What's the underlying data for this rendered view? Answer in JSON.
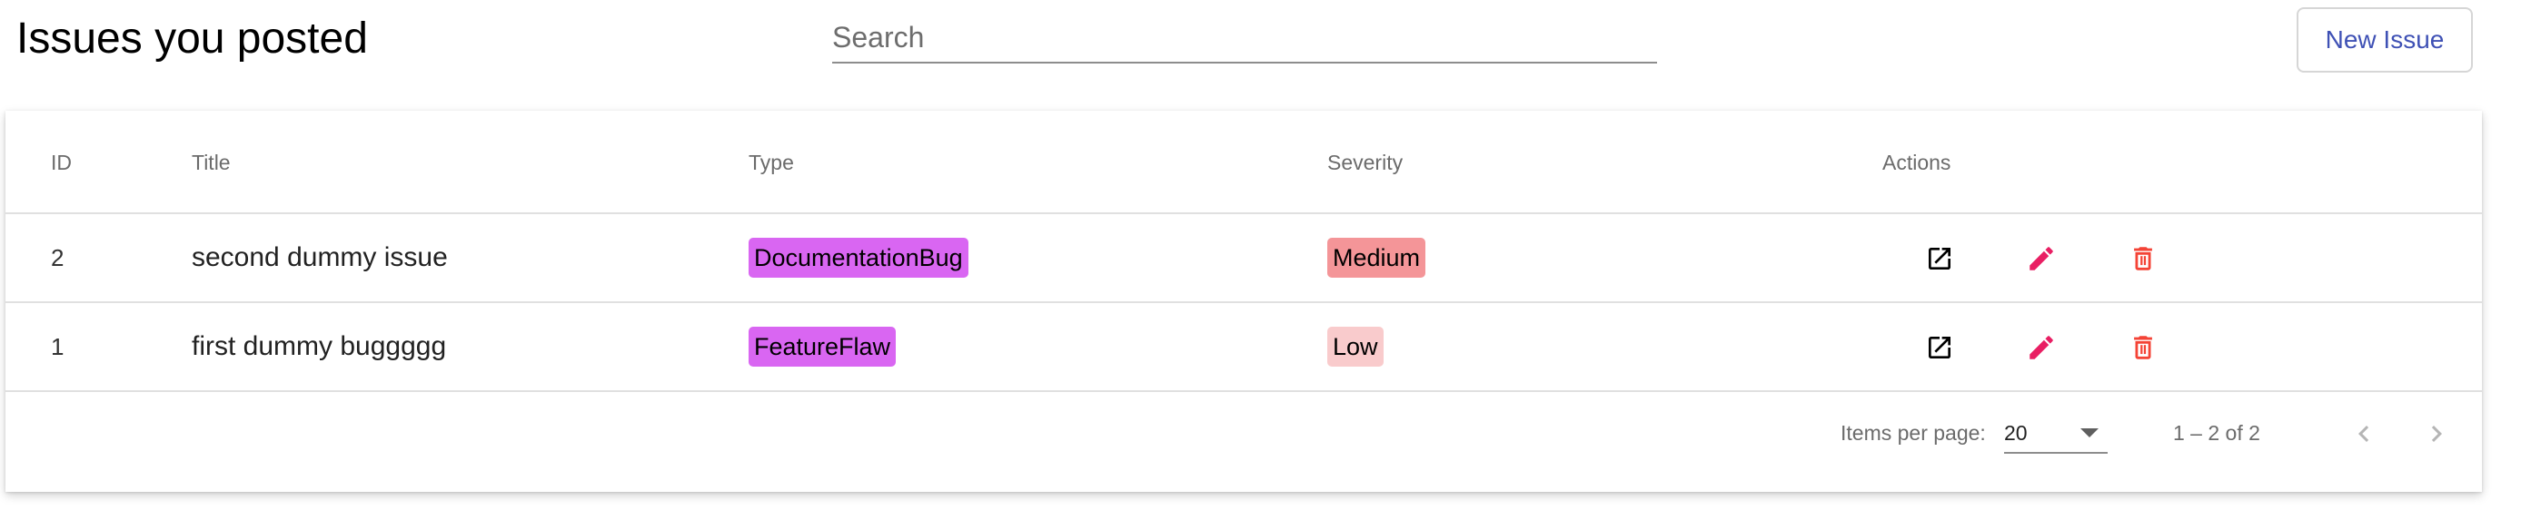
{
  "header": {
    "title": "Issues you posted",
    "search_placeholder": "Search",
    "search_value": "",
    "new_issue_label": "New Issue"
  },
  "table": {
    "columns": [
      "ID",
      "Title",
      "Type",
      "Severity",
      "Actions"
    ],
    "rows": [
      {
        "id": "2",
        "title": "second dummy issue",
        "type": "DocumentationBug",
        "severity": "Medium"
      },
      {
        "id": "1",
        "title": "first dummy buggggg",
        "type": "FeatureFlaw",
        "severity": "Low"
      }
    ],
    "action_icons": [
      "open-in-new-icon",
      "edit-pencil-icon",
      "delete-trash-icon"
    ]
  },
  "paginator": {
    "items_per_page_label": "Items per page:",
    "page_size": "20",
    "range_label": "1 – 2 of 2"
  },
  "colors": {
    "primary": "#3f51b5",
    "type_chip": "#d966f2",
    "severity_medium": "#f49598",
    "severity_low": "#f9cbcc",
    "edit_icon": "#e91e63",
    "delete_icon": "#f44336"
  }
}
